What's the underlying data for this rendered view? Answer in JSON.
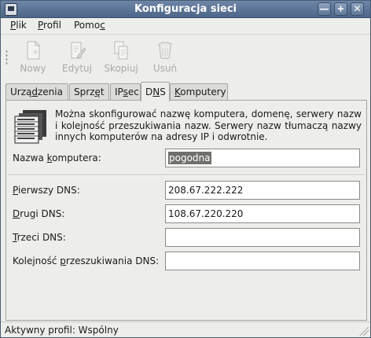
{
  "window": {
    "title": "Konfiguracja sieci",
    "controls": {
      "minimize": "—",
      "maximize": "+",
      "close": "✕"
    }
  },
  "menu": {
    "file": {
      "mnemonic": "P",
      "rest": "lik"
    },
    "profile": {
      "mnemonic": "P",
      "rest": "rofil"
    },
    "help": {
      "pre": "Pomo",
      "mnemonic": "c"
    }
  },
  "toolbar": {
    "new": "Nowy",
    "edit": "Edytuj",
    "copy": "Skopiuj",
    "delete": "Usuń"
  },
  "tabs": {
    "devices": {
      "pre": "Urzą",
      "mnemonic": "d",
      "rest": "zenia"
    },
    "hardware": {
      "pre": "Sprz",
      "mnemonic": "ę",
      "rest": "t"
    },
    "ipsec": {
      "pre": "IP",
      "mnemonic": "s",
      "rest": "ec"
    },
    "dns": {
      "pre": "D",
      "mnemonic": "N",
      "rest": "S"
    },
    "hosts": {
      "mnemonic": "K",
      "rest": "omputery"
    }
  },
  "dns_panel": {
    "description": "Można skonfigurować nazwę komputera, domenę, serwery nazw i kolejność przeszukiwania nazw. Serwery nazw tłumaczą nazwy innych komputerów na adresy IP i odwrotnie.",
    "hostname": {
      "pre": "Nazwa ",
      "mnemonic": "k",
      "rest": "omputera:",
      "value": "pogodna"
    },
    "primary_dns": {
      "mnemonic": "P",
      "rest": "ierwszy DNS:",
      "value": "208.67.222.222"
    },
    "secondary_dns": {
      "mnemonic": "D",
      "rest": "rugi DNS:",
      "value": "108.67.220.220"
    },
    "tertiary_dns": {
      "mnemonic": "T",
      "rest": "rzeci DNS:",
      "value": ""
    },
    "search_path": {
      "pre": "Kolejność ",
      "mnemonic": "p",
      "rest": "rzeszukiwania DNS:",
      "value": ""
    }
  },
  "status": {
    "active_profile": "Aktywny profil: Wspólny"
  }
}
